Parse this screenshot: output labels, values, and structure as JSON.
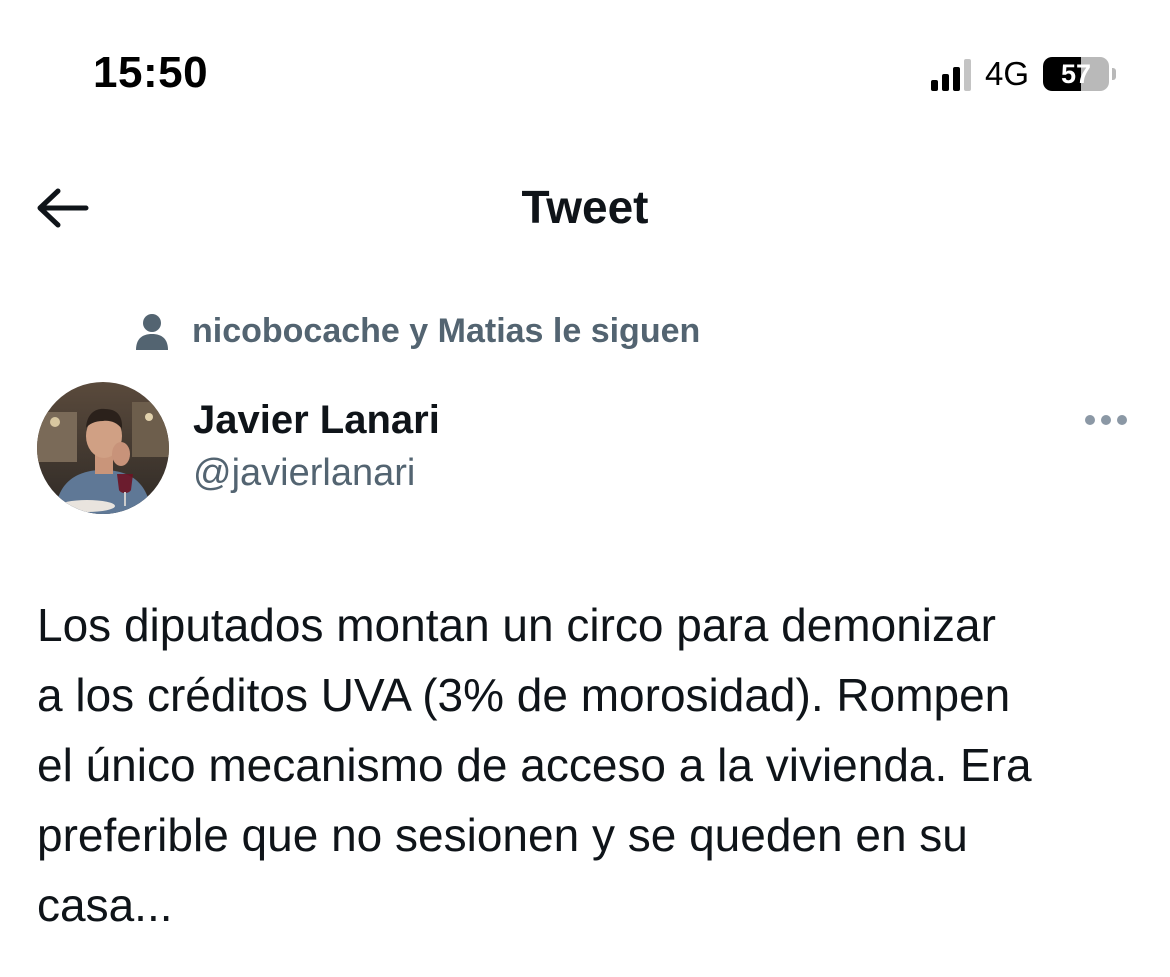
{
  "status_bar": {
    "time": "15:50",
    "network": "4G",
    "battery_level": "57",
    "battery_fraction": 0.57,
    "signal_bars_active": 3,
    "signal_bars_total": 4
  },
  "header": {
    "title": "Tweet",
    "back_icon": "arrow-left-icon"
  },
  "social_context": {
    "icon": "person-icon",
    "text": "nicobocache y Matias le siguen"
  },
  "author": {
    "name": "Javier Lanari",
    "handle": "@javierlanari"
  },
  "tweet": {
    "text": "Los diputados montan un circo para demonizar\na los créditos UVA (3% de morosidad). Rompen\nel único mecanismo de acceso a la vivienda. Era\npreferible que no sesionen y se queden en su\ncasa...",
    "more_icon": "more-horizontal-icon"
  },
  "colors": {
    "primary_text": "#0f1419",
    "secondary_text": "#536471",
    "more_icon": "#8b98a5",
    "background": "#ffffff"
  }
}
